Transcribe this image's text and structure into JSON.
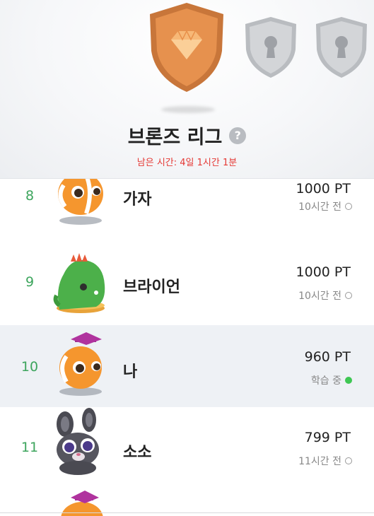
{
  "header": {
    "league_title": "브론즈 리그",
    "help_symbol": "?",
    "time_left": "남은 시간: 4일 1시간 1분",
    "badges": [
      {
        "name": "bronze-badge",
        "icon": "diamond-icon",
        "state": "unlocked",
        "color": "#e08a45"
      },
      {
        "name": "silver-badge",
        "icon": "keyhole-lock-icon",
        "state": "locked",
        "color": "#c8cbcf"
      },
      {
        "name": "silver-badge-2",
        "icon": "keyhole-lock-icon",
        "state": "locked",
        "color": "#c8cbcf"
      }
    ]
  },
  "rows": [
    {
      "rank": "8",
      "name": "가자",
      "points": "1000 PT",
      "status": "10시간 전",
      "status_type": "offline",
      "avatar": "orange-fish-avatar"
    },
    {
      "rank": "9",
      "name": "브라이언",
      "points": "1000 PT",
      "status": "10시간 전",
      "status_type": "offline",
      "avatar": "green-dino-avatar"
    },
    {
      "rank": "10",
      "name": "나",
      "points": "960 PT",
      "status": "학습 중",
      "status_type": "online",
      "avatar": "orange-fish-cap-avatar",
      "is_me": true
    },
    {
      "rank": "11",
      "name": "소소",
      "points": "799 PT",
      "status": "11시간 전",
      "status_type": "offline",
      "avatar": "gray-bunny-avatar"
    }
  ],
  "colors": {
    "rank": "#3da55d",
    "time_left": "#e53935",
    "online_dot": "#3ec753",
    "me_row_bg": "#eef1f5"
  }
}
